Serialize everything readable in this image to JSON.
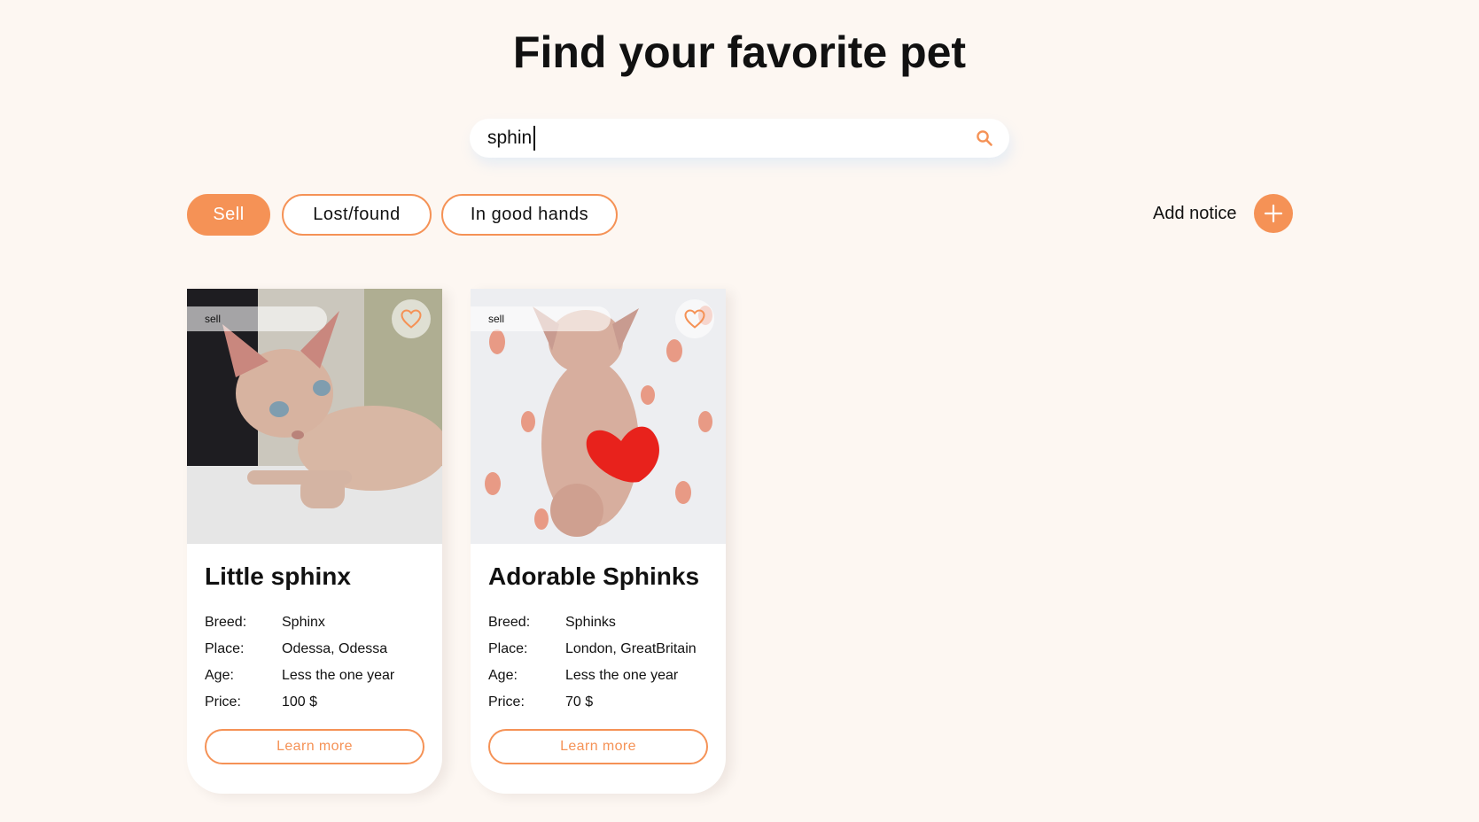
{
  "page": {
    "title": "Find your favorite pet"
  },
  "search": {
    "value": "sphin",
    "placeholder": "Search"
  },
  "filters": [
    {
      "label": "Sell",
      "active": true
    },
    {
      "label": "Lost/found",
      "active": false
    },
    {
      "label": "In good hands",
      "active": false
    }
  ],
  "add_notice": {
    "label": "Add notice"
  },
  "labels": {
    "breed": "Breed:",
    "place": "Place:",
    "age": "Age:",
    "price": "Price:",
    "learn_more": "Learn more"
  },
  "cards": [
    {
      "category": "sell",
      "title": "Little sphinx",
      "breed": "Sphinx",
      "place": "Odessa, Odessa",
      "age": "Less the one year",
      "price": "100 $"
    },
    {
      "category": "sell",
      "title": "Adorable Sphinks",
      "breed": "Sphinks",
      "place": "London, GreatBritain",
      "age": "Less the one year",
      "price": "70 $"
    }
  ],
  "colors": {
    "accent": "#F59256",
    "background": "#FDF7F2",
    "text": "#111111",
    "card": "#FFFFFF"
  }
}
